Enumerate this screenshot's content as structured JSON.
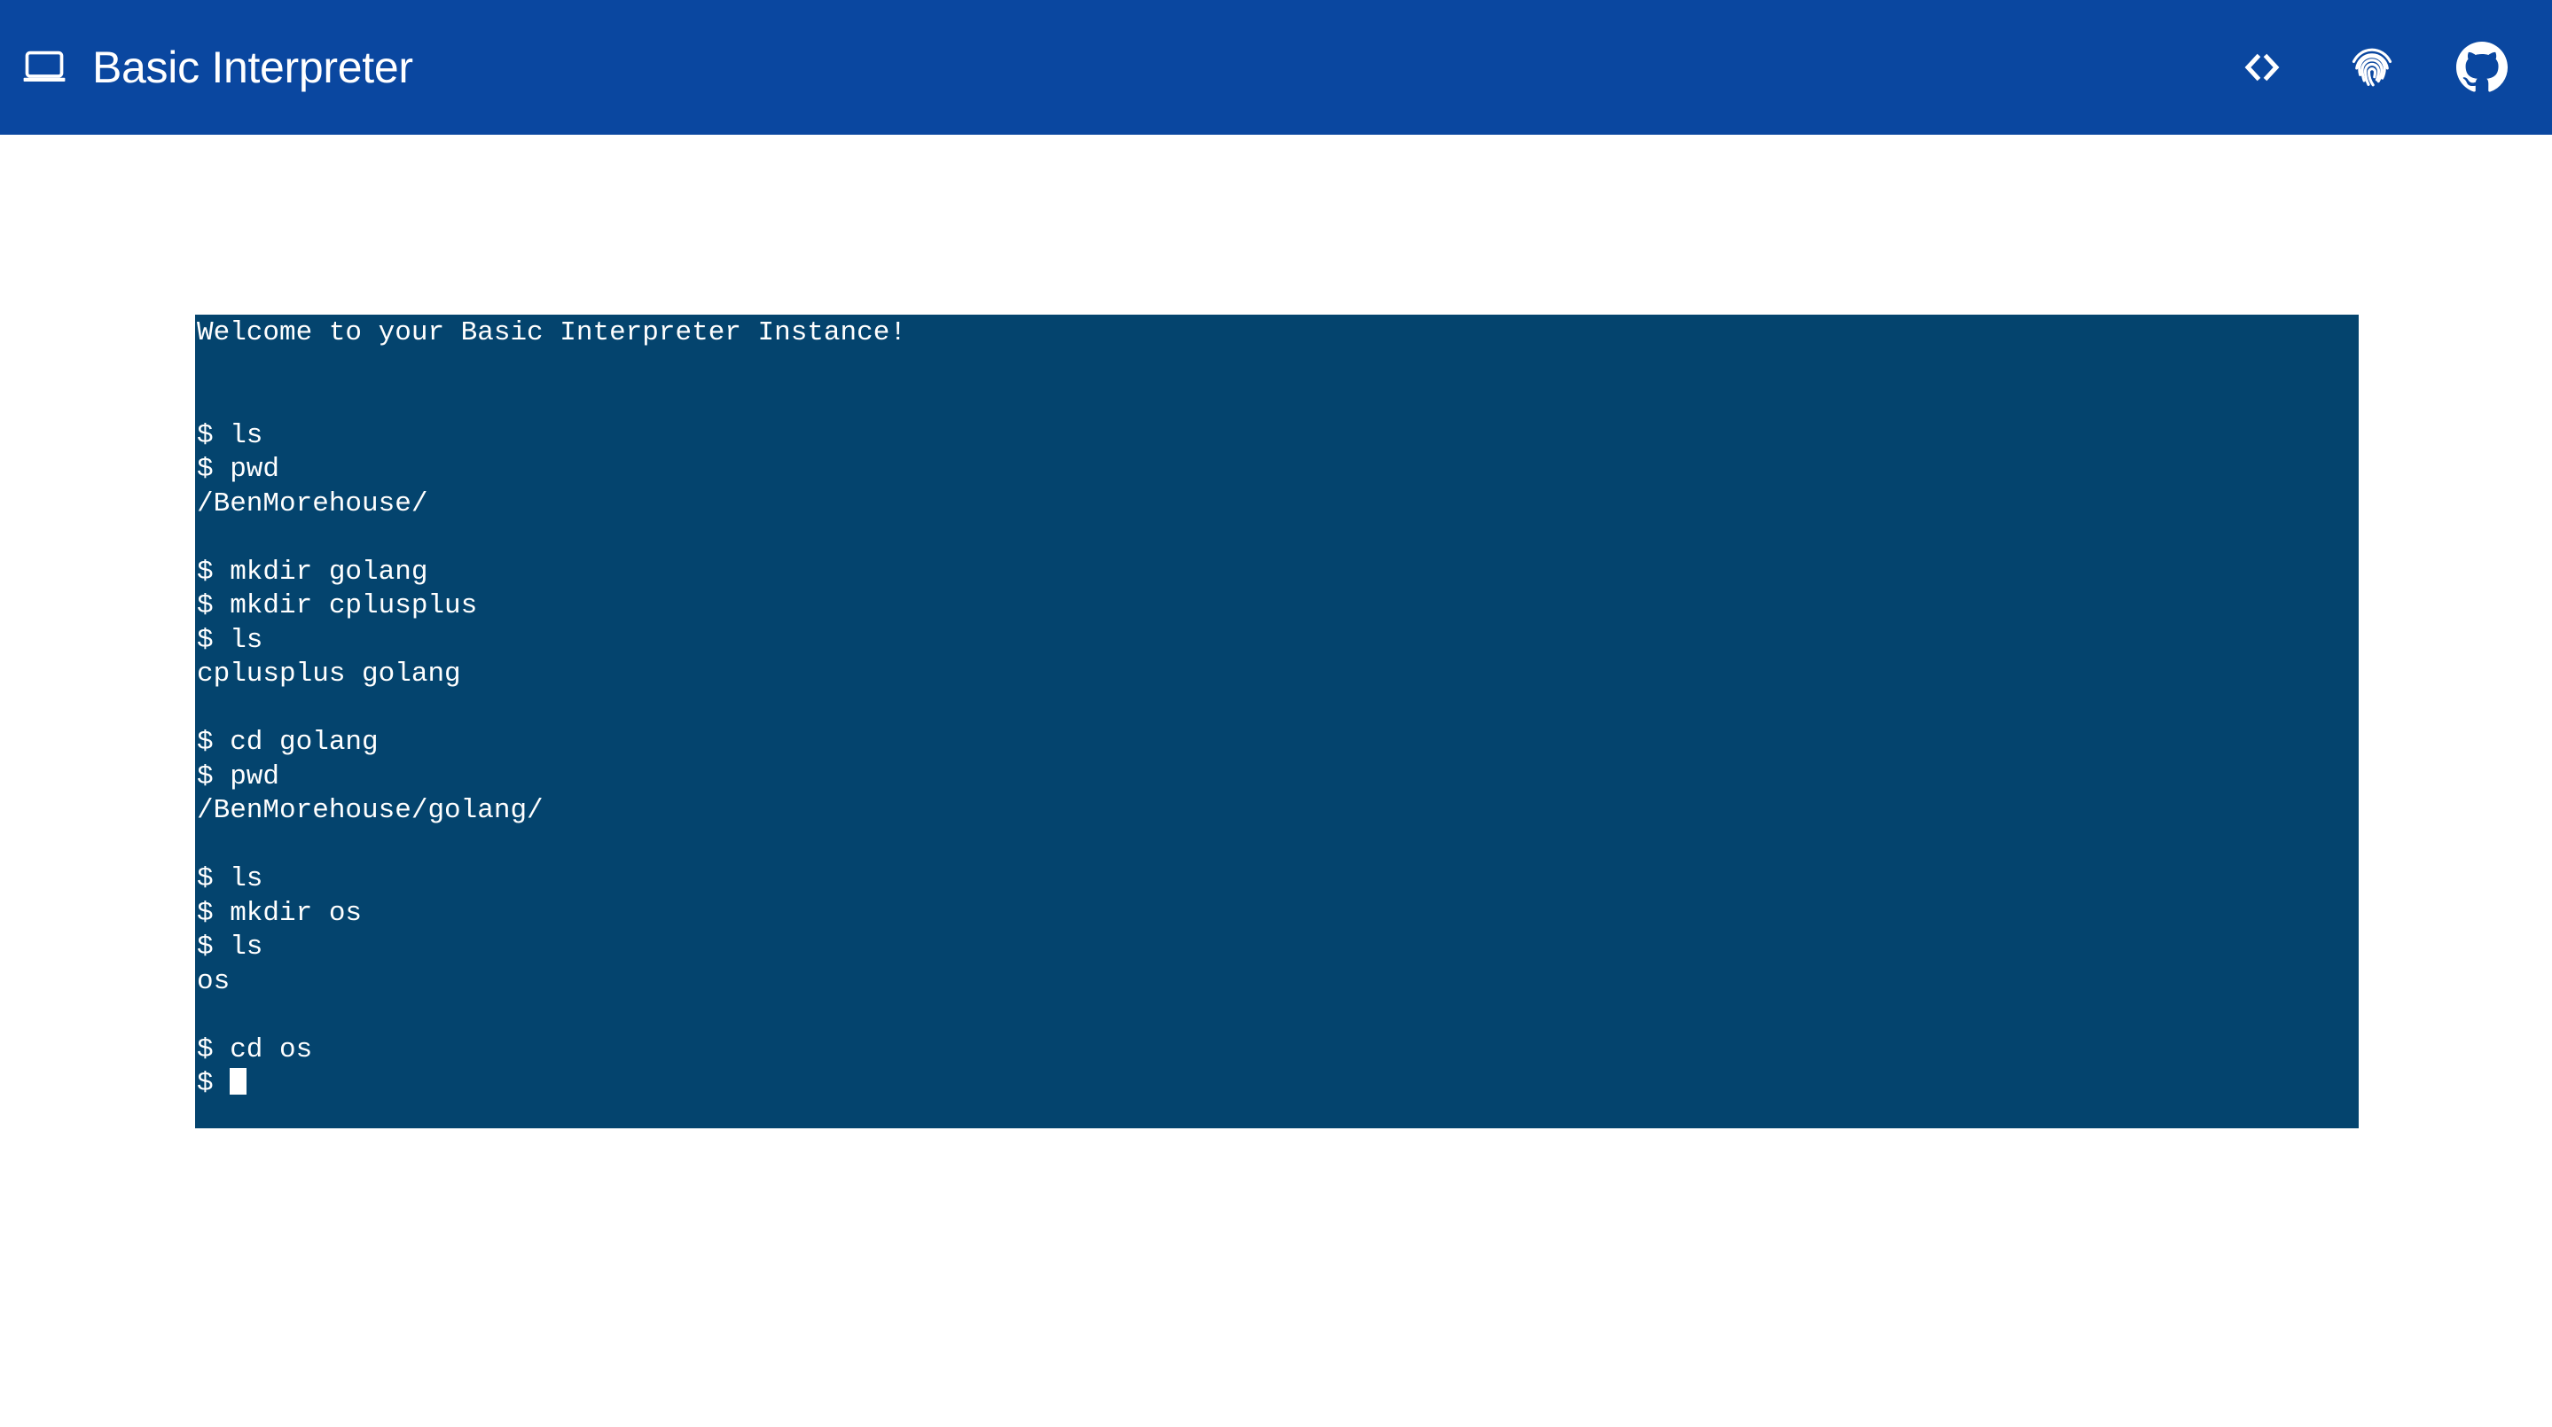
{
  "header": {
    "title": "Basic Interpreter",
    "brand_icon": "laptop-icon",
    "background_color": "#0a47a0",
    "text_color": "#ffffff",
    "actions": [
      {
        "name": "code-icon",
        "label": "<>",
        "title": "Source Code"
      },
      {
        "name": "fingerprint-icon",
        "label": "",
        "title": "Fingerprint"
      },
      {
        "name": "github-icon",
        "label": "",
        "title": "GitHub"
      }
    ]
  },
  "terminal": {
    "background_color": "#04446e",
    "text_color": "#ffffff",
    "prompt": "$",
    "welcome": "Welcome to your Basic Interpreter Instance!",
    "lines": [
      "Welcome to your Basic Interpreter Instance!",
      "",
      "",
      "$ ls",
      "$ pwd",
      "/BenMorehouse/",
      "",
      "$ mkdir golang",
      "$ mkdir cplusplus",
      "$ ls",
      "cplusplus golang",
      "",
      "$ cd golang",
      "$ pwd",
      "/BenMorehouse/golang/",
      "",
      "$ ls",
      "$ mkdir os",
      "$ ls",
      "os",
      "",
      "$ cd os"
    ],
    "current_prompt": "$ ",
    "cursor": "block"
  }
}
